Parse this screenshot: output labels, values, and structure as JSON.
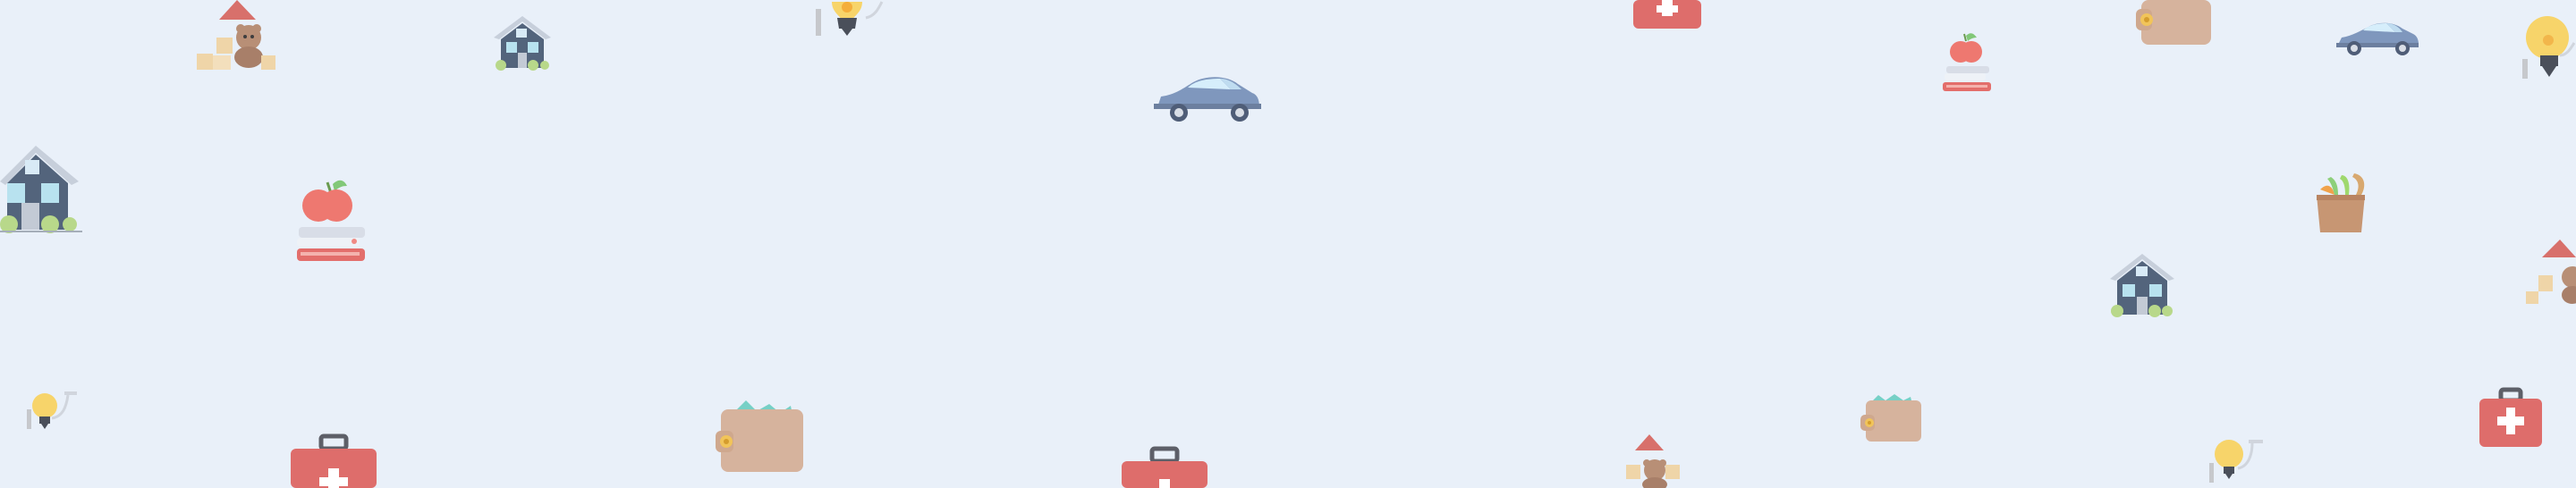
{
  "background": {
    "color": "#e9f0f9",
    "pattern": "tiled-household-expense-icons"
  },
  "palette": {
    "red": "#de6d6b",
    "brown": "#d6b39d",
    "slate": "#5f6c82",
    "yellow": "#f7d46a",
    "green": "#b8d88a",
    "blue_gray": "#7f97bd",
    "sand": "#efd5a8"
  },
  "icons": [
    {
      "kind": "toy-house-bear",
      "name": "toy-house-bear-icon"
    },
    {
      "kind": "house",
      "name": "house-icon"
    },
    {
      "kind": "lightbulb",
      "name": "lightbulb-icon"
    },
    {
      "kind": "first-aid-kit",
      "name": "first-aid-kit-icon"
    },
    {
      "kind": "wallet",
      "name": "wallet-icon"
    },
    {
      "kind": "car",
      "name": "car-icon"
    },
    {
      "kind": "apple-books",
      "name": "apple-books-icon"
    },
    {
      "kind": "groceries-bag",
      "name": "groceries-bag-icon"
    }
  ]
}
